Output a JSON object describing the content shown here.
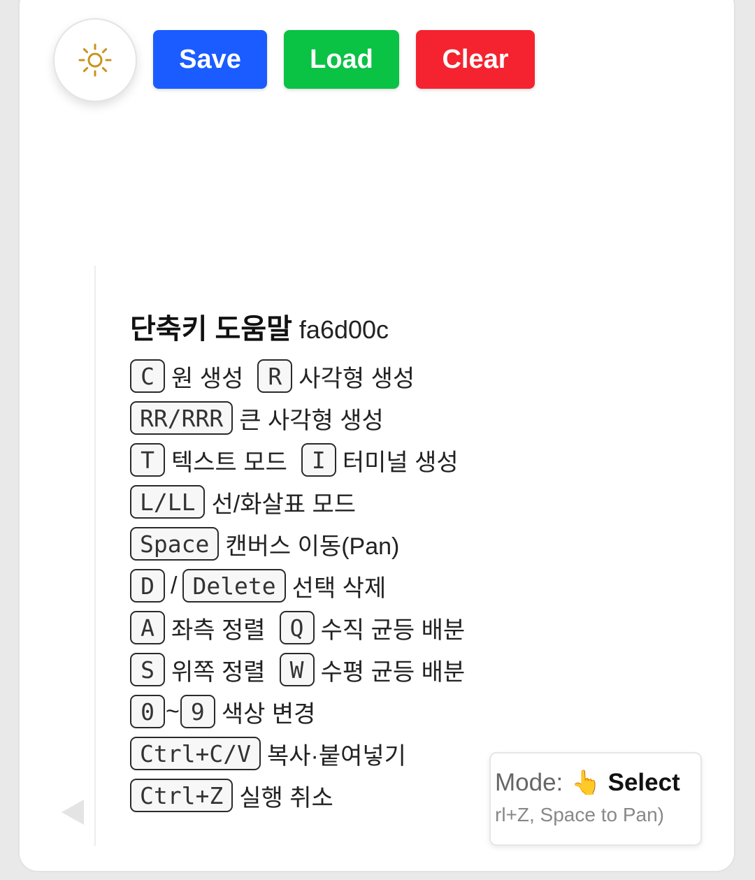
{
  "toolbar": {
    "theme_icon": "sun-icon",
    "save_label": "Save",
    "load_label": "Load",
    "clear_label": "Clear",
    "colors": {
      "save": "#1a5cff",
      "load": "#0ac244",
      "clear": "#f5232f"
    }
  },
  "help": {
    "title": "단축키 도움말",
    "hash": "fa6d00c",
    "rows": [
      {
        "k1": "C",
        "d1": "원 생성",
        "k2": "R",
        "d2": "사각형 생성"
      },
      {
        "k1": "RR/RRR",
        "d1": "큰 사각형 생성"
      },
      {
        "k1": "T",
        "d1": "텍스트 모드",
        "k2": "I",
        "d2": "터미널 생성"
      },
      {
        "k1": "L/LL",
        "d1": "선/화살표 모드"
      },
      {
        "k1": "Space",
        "d1": "캔버스 이동(Pan)"
      },
      {
        "k1": "D",
        "sep": "/",
        "k2": "Delete",
        "d1": "선택 삭제"
      },
      {
        "k1": "A",
        "d1": "좌측 정렬",
        "k2": "Q",
        "d2": "수직 균등 배분"
      },
      {
        "k1": "S",
        "d1": "위쪽 정렬",
        "k2": "W",
        "d2": "수평 균등 배분"
      },
      {
        "k1": "0",
        "sep": "~",
        "k2": "9",
        "d1": "색상 변경"
      },
      {
        "k1": "Ctrl+C/V",
        "d1": "복사·붙여넣기"
      },
      {
        "k1": "Ctrl+Z",
        "d1": "실행 취소"
      }
    ]
  },
  "status": {
    "mode_label": "Mode:",
    "mode_icon": "👆",
    "mode_value": "Select",
    "hint": "rl+Z, Space to Pan)"
  }
}
